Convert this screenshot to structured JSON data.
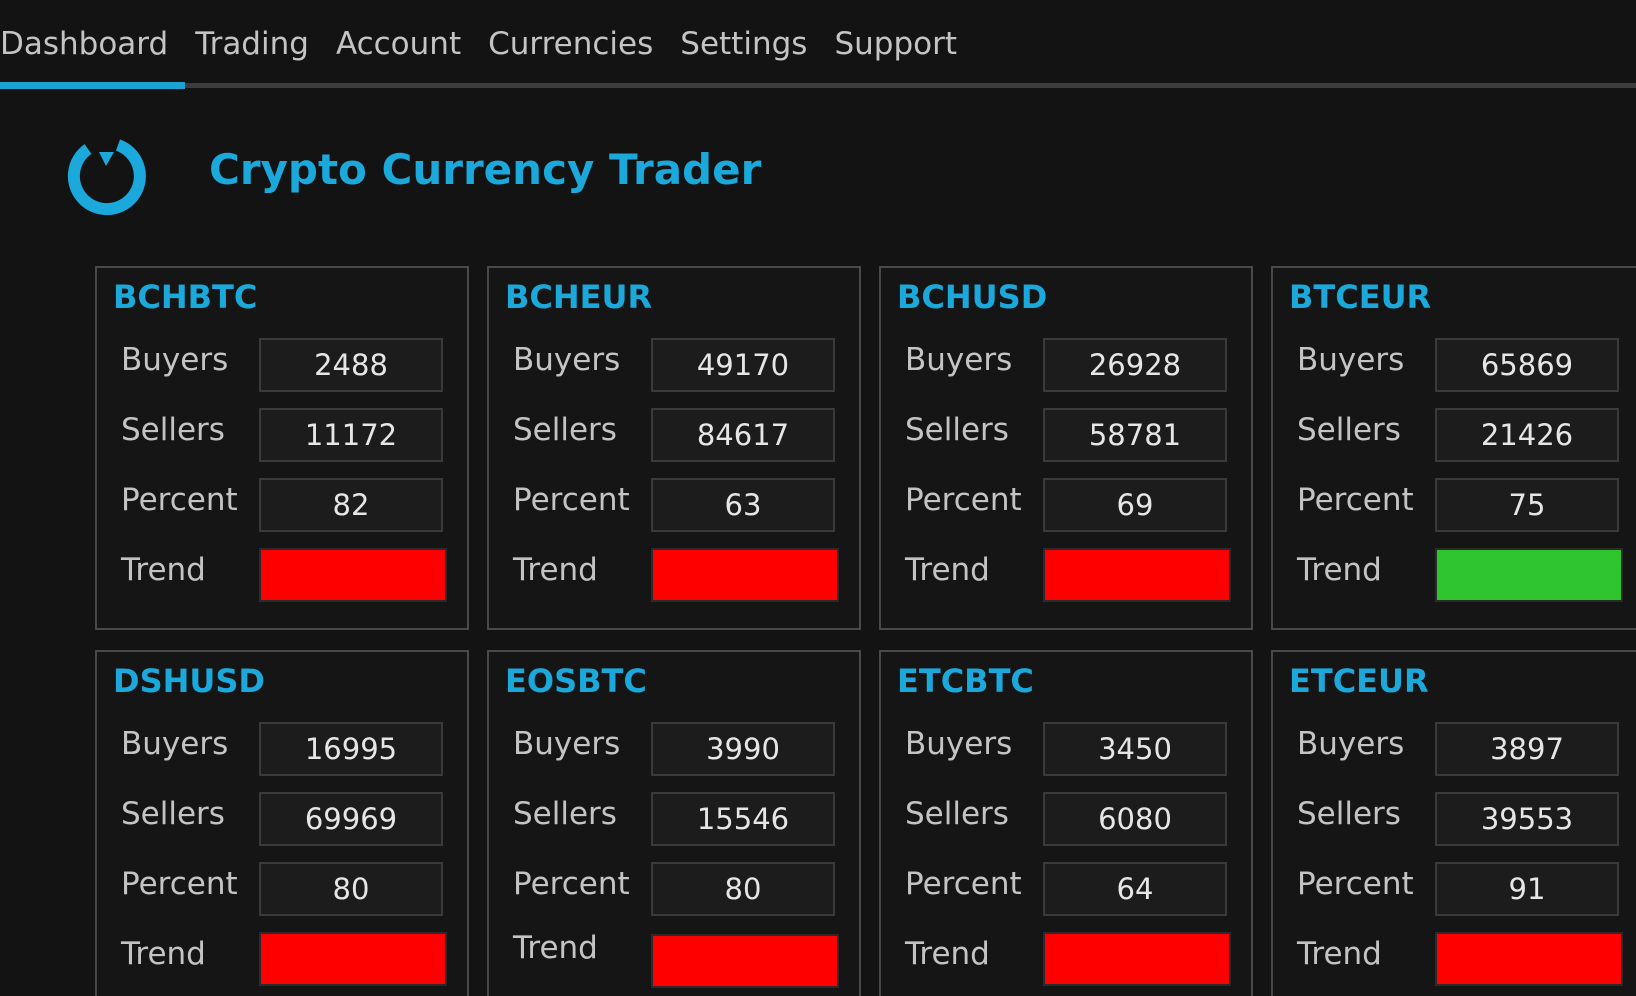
{
  "tabs": [
    {
      "label": "Dashboard",
      "active": true
    },
    {
      "label": "Trading"
    },
    {
      "label": "Account"
    },
    {
      "label": "Currencies"
    },
    {
      "label": "Settings"
    },
    {
      "label": "Support"
    }
  ],
  "app": {
    "title": "Crypto Currency Trader"
  },
  "labels": {
    "buyers": "Buyers",
    "sellers": "Sellers",
    "percent": "Percent",
    "trend": "Trend"
  },
  "colors": {
    "accent": "#1ba8da",
    "trend_down": "#ff0000",
    "trend_up": "#2ec52f"
  },
  "pairs": [
    {
      "name": "BCHBTC",
      "buyers": "2488",
      "sellers": "11172",
      "percent": "82",
      "trend": "down"
    },
    {
      "name": "BCHEUR",
      "buyers": "49170",
      "sellers": "84617",
      "percent": "63",
      "trend": "down"
    },
    {
      "name": "BCHUSD",
      "buyers": "26928",
      "sellers": "58781",
      "percent": "69",
      "trend": "down"
    },
    {
      "name": "BTCEUR",
      "buyers": "65869",
      "sellers": "21426",
      "percent": "75",
      "trend": "up"
    },
    {
      "name": "DSHUSD",
      "buyers": "16995",
      "sellers": "69969",
      "percent": "80",
      "trend": "down"
    },
    {
      "name": "EOSBTC",
      "buyers": "3990",
      "sellers": "15546",
      "percent": "80",
      "trend": "down"
    },
    {
      "name": "ETCBTC",
      "buyers": "3450",
      "sellers": "6080",
      "percent": "64",
      "trend": "down"
    },
    {
      "name": "ETCEUR",
      "buyers": "3897",
      "sellers": "39553",
      "percent": "91",
      "trend": "down"
    }
  ]
}
